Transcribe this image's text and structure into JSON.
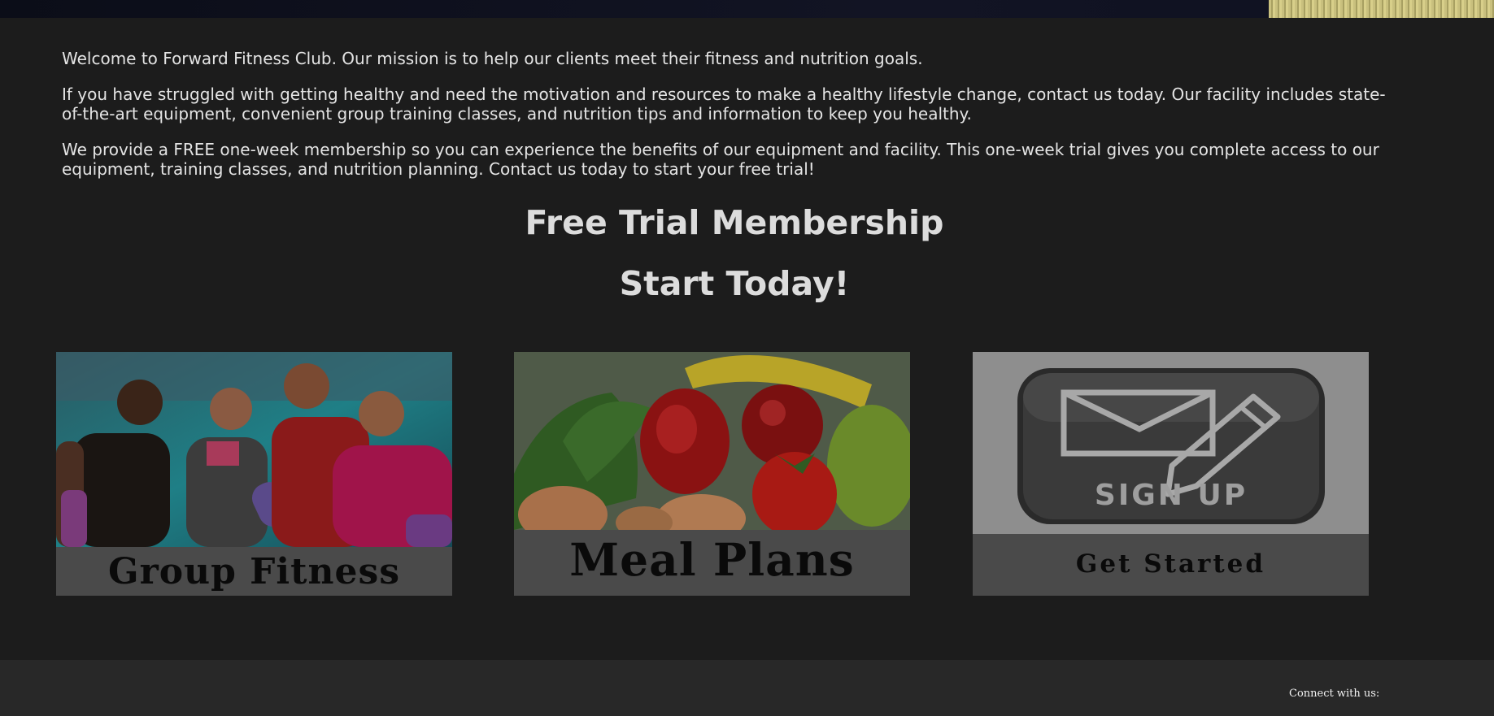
{
  "intro": {
    "p1": "Welcome to Forward Fitness Club. Our mission is to help our clients meet their fitness and nutrition goals.",
    "p2": "If you have struggled with getting healthy and need the motivation and resources to make a healthy lifestyle change, contact us today. Our facility includes state-of-the-art equipment, convenient group training classes, and nutrition tips and information to keep you healthy.",
    "p3": "We provide a FREE one-week membership so you can experience the benefits of our equipment and facility. This one-week trial gives you complete access to our equipment, training classes, and nutrition planning. Contact us today to start your free trial!"
  },
  "headings": {
    "free_trial": "Free Trial Membership",
    "start_today": "Start Today!"
  },
  "cards": [
    {
      "caption": "Group Fitness"
    },
    {
      "caption": "Meal Plans"
    },
    {
      "caption": "Get Started",
      "logo_text": "SIGN UP"
    }
  ],
  "footer": {
    "connect": "Connect with us:"
  },
  "colors": {
    "background": "#1c1c1c",
    "footer": "#282828",
    "caption_band": "#4a4a4a"
  }
}
